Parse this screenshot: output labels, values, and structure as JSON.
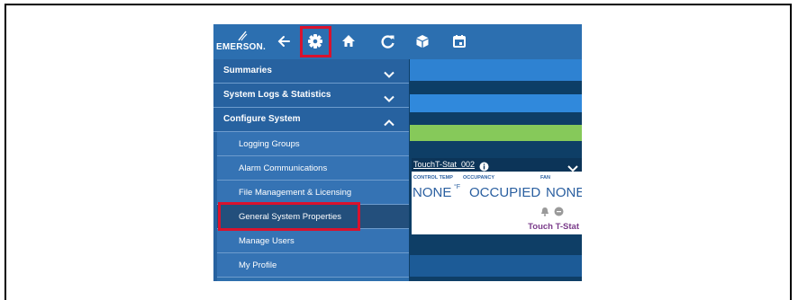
{
  "brand": {
    "logo_text": "EMERSON."
  },
  "toolbar": {
    "icons": [
      "arrow-left-icon",
      "gear-icon",
      "home-icon",
      "refresh-icon",
      "cube-icon",
      "calendar-icon"
    ],
    "accent_color": "#d9122d"
  },
  "sidebar": {
    "sections": [
      {
        "label": "Summaries",
        "expanded": false
      },
      {
        "label": "System Logs & Statistics",
        "expanded": false
      },
      {
        "label": "Configure System",
        "expanded": true
      }
    ],
    "items": [
      {
        "label": "Logging Groups"
      },
      {
        "label": "Alarm Communications"
      },
      {
        "label": "File Management & Licensing"
      },
      {
        "label": "General System Properties"
      },
      {
        "label": "Manage Users"
      },
      {
        "label": "My Profile"
      }
    ]
  },
  "device_card": {
    "title": "TouchT-Stat_002",
    "columns": [
      {
        "label": "CONTROL TEMP",
        "value": "NONE",
        "unit": "°F"
      },
      {
        "label": "OCCUPANCY",
        "value": "OCCUPIED"
      },
      {
        "label": "FAN",
        "value": "NONE"
      }
    ],
    "type_label": "Touch T-Stat",
    "type_color": "#7a3b8a"
  }
}
